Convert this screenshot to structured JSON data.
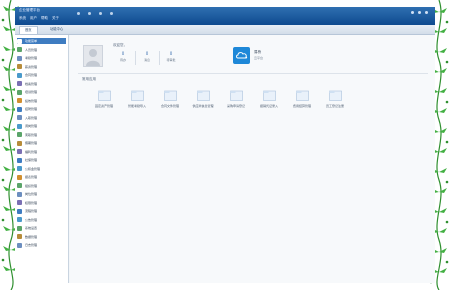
{
  "window": {
    "title": "企业管理平台",
    "menu": [
      "系统",
      "用户",
      "帮助",
      "关于"
    ]
  },
  "tabs": [
    "首页",
    "功能中心"
  ],
  "sidebar": {
    "items": [
      {
        "label": "功能菜单",
        "color": "#3e7cc1"
      },
      {
        "label": "人员管理",
        "color": "#5aa469"
      },
      {
        "label": "考勤管理",
        "color": "#6c8ebf"
      },
      {
        "label": "薪资管理",
        "color": "#b78c3a"
      },
      {
        "label": "合同管理",
        "color": "#4a9acb"
      },
      {
        "label": "档案管理",
        "color": "#7a6fb3"
      },
      {
        "label": "培训管理",
        "color": "#5aa469"
      },
      {
        "label": "绩效管理",
        "color": "#d18f2f"
      },
      {
        "label": "招聘管理",
        "color": "#3e7cc1"
      },
      {
        "label": "入职管理",
        "color": "#6c8ebf"
      },
      {
        "label": "调岗管理",
        "color": "#4a9acb"
      },
      {
        "label": "离职管理",
        "color": "#5aa469"
      },
      {
        "label": "假期管理",
        "color": "#b78c3a"
      },
      {
        "label": "福利管理",
        "color": "#7a6fb3"
      },
      {
        "label": "社保管理",
        "color": "#3e7cc1"
      },
      {
        "label": "公积金管理",
        "color": "#4a9acb"
      },
      {
        "label": "报表管理",
        "color": "#d18f2f"
      },
      {
        "label": "组织管理",
        "color": "#5aa469"
      },
      {
        "label": "岗位管理",
        "color": "#6c8ebf"
      },
      {
        "label": "权限管理",
        "color": "#7a6fb3"
      },
      {
        "label": "流程管理",
        "color": "#3e7cc1"
      },
      {
        "label": "公告管理",
        "color": "#4a9acb"
      },
      {
        "label": "系统设置",
        "color": "#5aa469"
      },
      {
        "label": "数据管理",
        "color": "#b78c3a"
      },
      {
        "label": "日志管理",
        "color": "#6c8ebf"
      }
    ]
  },
  "profile": {
    "welcome": "欢迎您，",
    "stats": [
      {
        "value": "0",
        "label": "待办"
      },
      {
        "value": "0",
        "label": "消息"
      },
      {
        "value": "0",
        "label": "待审批"
      }
    ],
    "cloud_name": "易桥",
    "cloud_sub": "云平台"
  },
  "section_title": "常用应用",
  "apps": [
    {
      "label": "固定资产管理"
    },
    {
      "label": "智能考勤导入"
    },
    {
      "label": "合同文件管理"
    },
    {
      "label": "供应商信息管理"
    },
    {
      "label": "采购申请登记"
    },
    {
      "label": "报销凭证录入"
    },
    {
      "label": "费用结算管理"
    },
    {
      "label": "员工登记注册"
    }
  ],
  "colors": {
    "accent": "#3e7cc1",
    "titlebar": "#1a5aa0",
    "cloud": "#1e88d8",
    "vine": "#3aa03a"
  }
}
